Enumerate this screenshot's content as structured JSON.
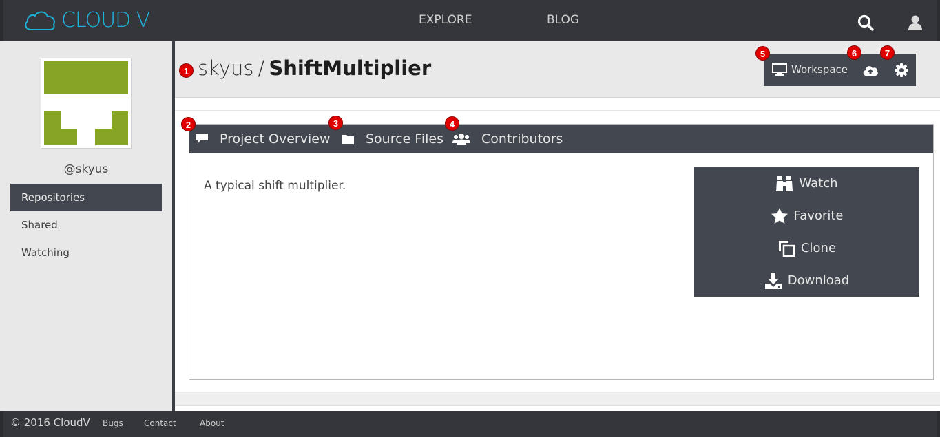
{
  "brand": {
    "name": "CLOUD V",
    "accent": "#1fb3dc"
  },
  "nav": {
    "explore": "EXPLORE",
    "blog": "BLOG"
  },
  "sidebar": {
    "username": "@skyus",
    "items": [
      {
        "label": "Repositories",
        "active": true
      },
      {
        "label": "Shared",
        "active": false
      },
      {
        "label": "Watching",
        "active": false
      }
    ]
  },
  "repo": {
    "owner": "skyus",
    "separator": "/",
    "name": "ShiftMultiplier"
  },
  "toolbar": {
    "workspace": "Workspace"
  },
  "tabs": [
    {
      "label": "Project Overview",
      "icon": "comment-icon"
    },
    {
      "label": "Source Files",
      "icon": "folder-icon"
    },
    {
      "label": "Contributors",
      "icon": "users-icon"
    }
  ],
  "overview": {
    "description": "A typical shift multiplier."
  },
  "actions": [
    {
      "label": "Watch",
      "icon": "binoculars-icon"
    },
    {
      "label": "Favorite",
      "icon": "star-icon"
    },
    {
      "label": "Clone",
      "icon": "clone-icon"
    },
    {
      "label": "Download",
      "icon": "download-icon"
    }
  ],
  "markers": [
    "1",
    "2",
    "3",
    "4",
    "5",
    "6",
    "7"
  ],
  "footer": {
    "copyright": "© 2016 CloudV",
    "bugs": "Bugs",
    "contact": "Contact",
    "about": "About"
  },
  "colors": {
    "panel_dark": "#434850",
    "marker_red": "#e00000",
    "avatar_green": "#86a525"
  }
}
